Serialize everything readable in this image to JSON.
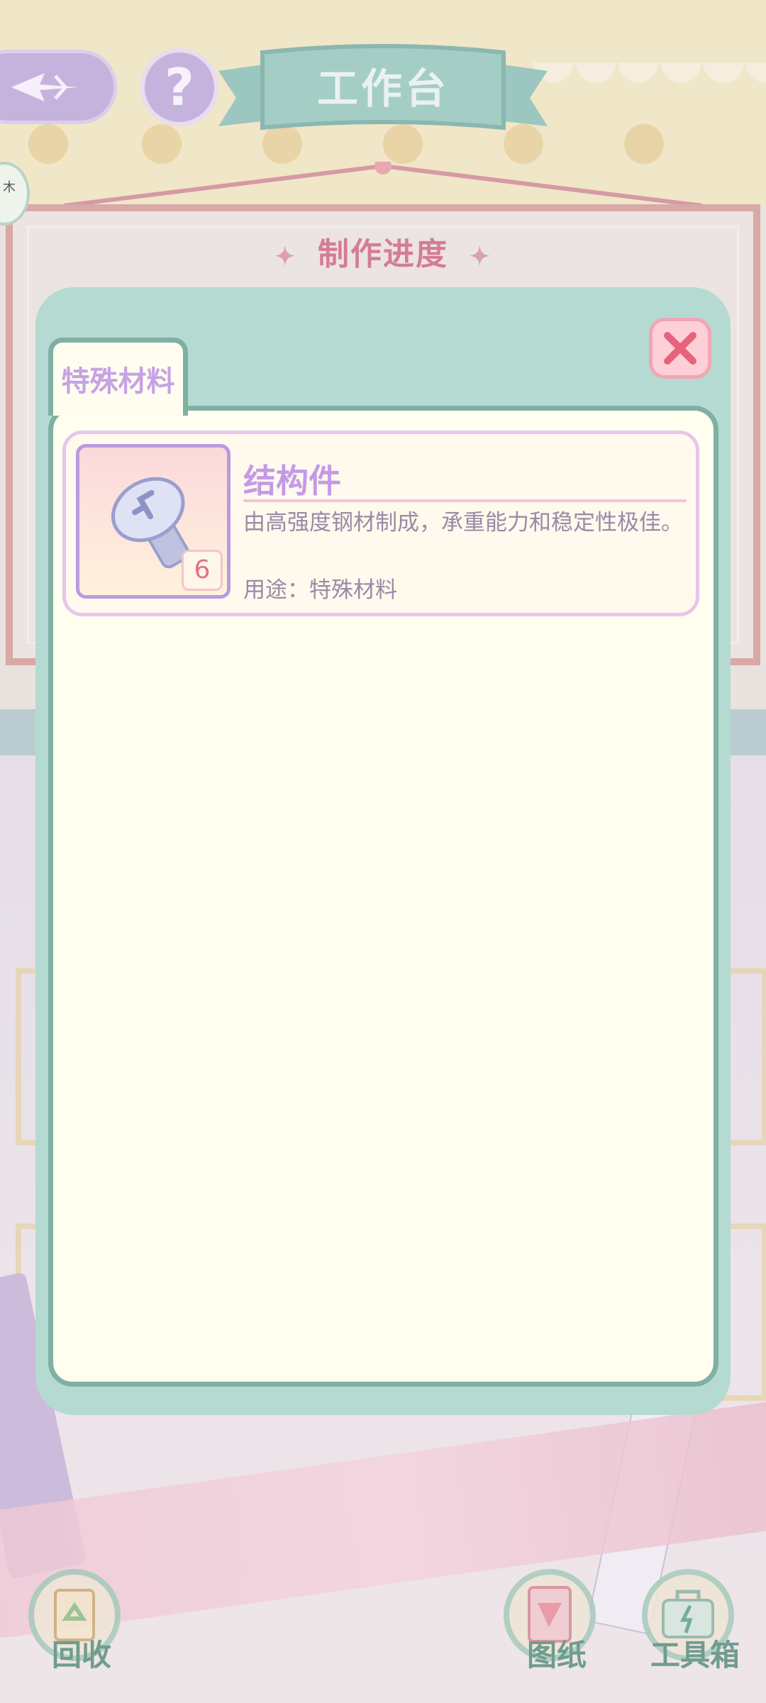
{
  "header": {
    "title": "工作台",
    "help_glyph": "?",
    "side_avatar_text": "木"
  },
  "background": {
    "progress_title": "制作进度"
  },
  "modal": {
    "tab_label": "特殊材料",
    "items": [
      {
        "name": "结构件",
        "count": "6",
        "description": "由高强度钢材制成，承重能力和稳定性极佳。",
        "usage": "用途：特殊材料",
        "icon": "bolt-screw-icon"
      }
    ]
  },
  "bottom_nav": {
    "recycle": "回收",
    "blueprint": "图纸",
    "toolbox": "工具箱"
  },
  "colors": {
    "modal_bg": "#b5dad2",
    "modal_border": "#7fb0a3",
    "item_name": "#c49ae6",
    "count_text": "#e07284",
    "close_button": "#fdd0d8"
  }
}
